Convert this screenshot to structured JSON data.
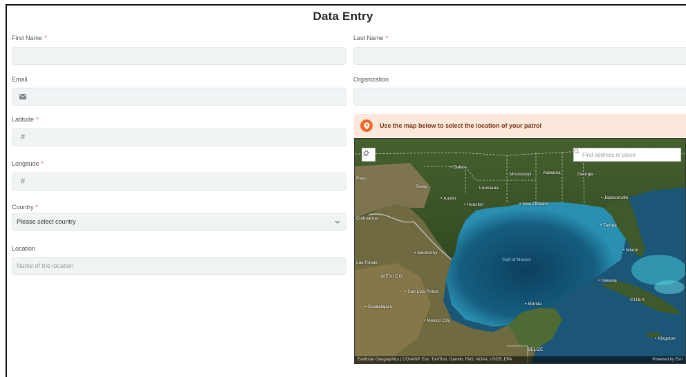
{
  "title": "Data Entry",
  "required_mark": "*",
  "fields": {
    "first_name": {
      "label": "First Name",
      "value": ""
    },
    "last_name": {
      "label": "Last Name",
      "value": ""
    },
    "email": {
      "label": "Email",
      "value": "",
      "icon": "envelope-icon"
    },
    "organization": {
      "label": "Organization",
      "value": ""
    },
    "latitude": {
      "label": "Latitude",
      "value": "",
      "icon": "hash-icon"
    },
    "longitude": {
      "label": "Longitude",
      "value": "",
      "icon": "hash-icon"
    },
    "country": {
      "label": "Country",
      "selected": "Please select country"
    },
    "location": {
      "label": "Location",
      "placeholder": "Name of the location"
    }
  },
  "map_banner": "Use the map below to select the location of your patrol",
  "map": {
    "search_placeholder": "Find address or place",
    "attribution": "Earthstar Geographics | CONANP, Esri, TomTom, Garmin, FAO, NOAA, USGS, EPA",
    "powered_by": "Powered by Esri",
    "labels": {
      "dallas": "Dallas",
      "texas": "Texas",
      "austin": "Austin",
      "houston": "Houston",
      "louisiana": "Louisiana",
      "mississippi": "Mississippi",
      "alabama": "Alabama",
      "georgia": "Georgia",
      "jacksonville": "Jacksonville",
      "new_orleans": "New Orleans",
      "tampa": "Tampa",
      "miami": "Miami",
      "chihuahua": "Chihuahua",
      "monterrey": "Monterrey",
      "las_rosas": "Las Rosas",
      "mexico": "MEXICO",
      "san_luis": "San Luis Potosí",
      "guadalajara": "Guadalajara",
      "mexico_city": "Mexico City",
      "gulf": "Gulf of Mexico",
      "havana": "Havana",
      "cuba": "CUBA",
      "merida": "Mérida",
      "belize": "BELIZE",
      "kingston": "Kingston",
      "paso": "Paso"
    }
  },
  "colors": {
    "accent": "#ef6b2b",
    "banner_bg": "#fde9dc",
    "field_bg": "#f1f4f5",
    "required": "#e0584a"
  }
}
